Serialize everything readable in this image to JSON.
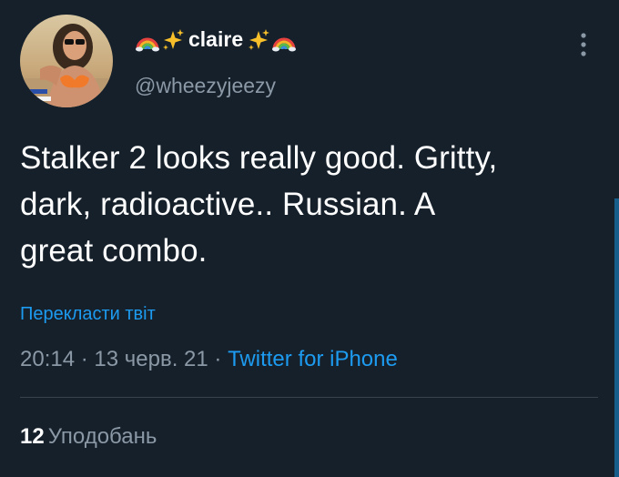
{
  "author": {
    "display_name": "claire",
    "name_prefix_icons": [
      "rainbow-icon",
      "sparkles-icon"
    ],
    "name_suffix_icons": [
      "sparkles-icon",
      "rainbow-icon"
    ],
    "handle": "@wheezyjeezy"
  },
  "tweet": {
    "lines": [
      "Stalker 2 looks really good. Gritty,",
      "dark, radioactive.. Russian. A",
      "great combo."
    ]
  },
  "translate_link": "Перекласти твіт",
  "meta": {
    "time": "20:14",
    "separator": "·",
    "date": "13 черв. 21",
    "source": "Twitter for iPhone"
  },
  "stats": {
    "likes_count": "12",
    "likes_label": "Уподобань"
  },
  "colors": {
    "background": "#15202b",
    "text_primary": "#ffffff",
    "text_secondary": "#8b98a5",
    "link": "#1d9bf0",
    "divider": "#38444d"
  }
}
